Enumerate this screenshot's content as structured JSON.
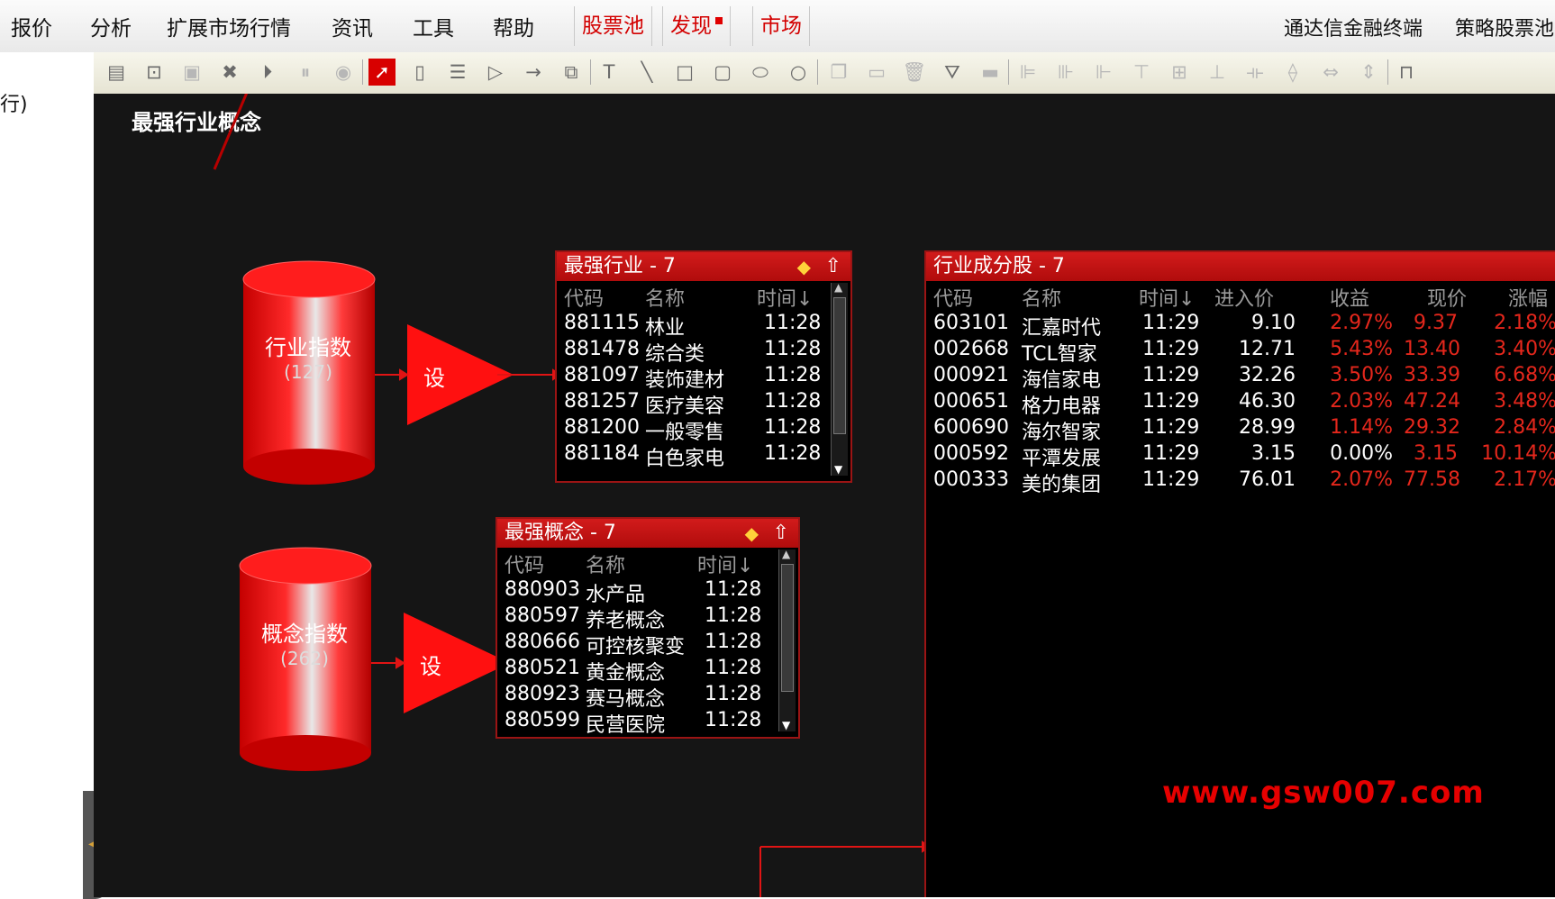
{
  "menubar": {
    "left_items": [
      "报价",
      "分析",
      "扩展市场行情",
      "资讯",
      "工具",
      "帮助"
    ],
    "red_items": [
      "股票池",
      "发现",
      "市场"
    ],
    "right_items": [
      "通达信金融终端",
      "策略股票池"
    ]
  },
  "left_strip": {
    "fragment_text": "行)"
  },
  "canvas": {
    "title": "最强行业概念",
    "watermark": "www.gsw007.com"
  },
  "nodes": {
    "industry_index": {
      "label": "行业指数",
      "count": "(127)",
      "setter_label": "设"
    },
    "concept_index": {
      "label": "概念指数",
      "count": "(262)",
      "setter_label": "设"
    }
  },
  "panels": {
    "strong_industry": {
      "title": "最强行业 - 7",
      "headers": [
        "代码",
        "名称",
        "时间↓"
      ],
      "rows": [
        [
          "881115",
          "林业",
          "11:28"
        ],
        [
          "881478",
          "综合类",
          "11:28"
        ],
        [
          "881097",
          "装饰建材",
          "11:28"
        ],
        [
          "881257",
          "医疗美容",
          "11:28"
        ],
        [
          "881200",
          "一般零售",
          "11:28"
        ],
        [
          "881184",
          "白色家电",
          "11:28"
        ]
      ]
    },
    "strong_concept": {
      "title": "最强概念 - 7",
      "headers": [
        "代码",
        "名称",
        "时间↓"
      ],
      "rows": [
        [
          "880903",
          "水产品",
          "11:28"
        ],
        [
          "880597",
          "养老概念",
          "11:28"
        ],
        [
          "880666",
          "可控核聚变",
          "11:28"
        ],
        [
          "880521",
          "黄金概念",
          "11:28"
        ],
        [
          "880923",
          "赛马概念",
          "11:28"
        ],
        [
          "880599",
          "民营医院",
          "11:28"
        ]
      ]
    },
    "components": {
      "title": "行业成分股 - 7",
      "headers": [
        "代码",
        "名称",
        "时间↓",
        "进入价",
        "收益",
        "现价",
        "涨幅"
      ],
      "rows": [
        [
          "603101",
          "汇嘉时代",
          "11:29",
          "9.10",
          "2.97%",
          "9.37",
          "2.18%"
        ],
        [
          "002668",
          "TCL智家",
          "11:29",
          "12.71",
          "5.43%",
          "13.40",
          "3.40%"
        ],
        [
          "000921",
          "海信家电",
          "11:29",
          "32.26",
          "3.50%",
          "33.39",
          "6.68%"
        ],
        [
          "000651",
          "格力电器",
          "11:29",
          "46.30",
          "2.03%",
          "47.24",
          "3.48%"
        ],
        [
          "600690",
          "海尔智家",
          "11:29",
          "28.99",
          "1.14%",
          "29.32",
          "2.84%"
        ],
        [
          "000592",
          "平潭发展",
          "11:29",
          "3.15",
          "0.00%",
          "3.15",
          "10.14%"
        ],
        [
          "000333",
          "美的集团",
          "11:29",
          "76.01",
          "2.07%",
          "77.58",
          "2.17%"
        ]
      ]
    }
  },
  "toolbar_icons": [
    "new-doc-icon",
    "open-icon",
    "save-icon",
    "delete-icon",
    "play-icon",
    "pause-icon",
    "stop-icon",
    "pointer-icon",
    "rounded-rect-icon",
    "list-icon",
    "triangle-icon",
    "arrow-right-icon",
    "multi-window-icon",
    "text-icon",
    "line-icon",
    "square-icon",
    "round-square-icon",
    "ellipse-icon",
    "circle-icon",
    "copy-icon",
    "paste-icon",
    "trash-icon",
    "fill-icon",
    "line-width-icon",
    "align-left-icon",
    "align-center-icon",
    "align-right-icon",
    "align-top-icon",
    "align-middle-icon",
    "align-bottom-icon",
    "space-h-icon",
    "space-v-icon",
    "same-width-icon",
    "same-height-icon",
    "more-icon"
  ],
  "colors": {
    "accent_red": "#d80000",
    "canvas_bg": "#151515",
    "gain_red": "#e5271c"
  }
}
